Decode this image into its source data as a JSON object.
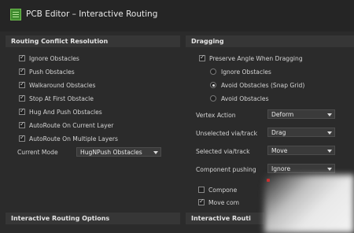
{
  "window": {
    "title": "PCB Editor – Interactive Routing"
  },
  "sections": {
    "conflict": {
      "title": "Routing Conflict Resolution"
    },
    "dragging": {
      "title": "Dragging"
    },
    "options": {
      "title": "Interactive Routing Options"
    },
    "routing_partial": {
      "title": "Interactive Routi"
    }
  },
  "conflict_options": [
    {
      "label": "Ignore Obstacles",
      "checked": true
    },
    {
      "label": "Push Obstacles",
      "checked": true
    },
    {
      "label": "Walkaround Obstacles",
      "checked": true
    },
    {
      "label": "Stop At First Obstacle",
      "checked": true
    },
    {
      "label": "Hug And Push Obstacles",
      "checked": true
    },
    {
      "label": "AutoRoute On Current Layer",
      "checked": true
    },
    {
      "label": "AutoRoute On Multiple Layers",
      "checked": true
    }
  ],
  "current_mode": {
    "label": "Current Mode",
    "value": "HugNPush Obstacles"
  },
  "dragging": {
    "preserve_angle": {
      "label": "Preserve Angle When Dragging",
      "checked": true
    },
    "radios": [
      {
        "label": "Ignore Obstacles",
        "selected": false
      },
      {
        "label": "Avoid Obstacles (Snap Grid)",
        "selected": true
      },
      {
        "label": "Avoid Obstacles",
        "selected": false
      }
    ],
    "fields": [
      {
        "label": "Vertex Action",
        "value": "Deform"
      },
      {
        "label": "Unselected via/track",
        "value": "Drag"
      },
      {
        "label": "Selected via/track",
        "value": "Move"
      },
      {
        "label": "Component pushing",
        "value": "Ignore"
      }
    ],
    "extra_checkboxes": [
      {
        "label": "Compone",
        "checked": false
      },
      {
        "label": "Move com",
        "checked": true
      }
    ]
  },
  "colors": {
    "background": "#2b2b2b",
    "header": "#363636",
    "titlebar": "#252525"
  }
}
